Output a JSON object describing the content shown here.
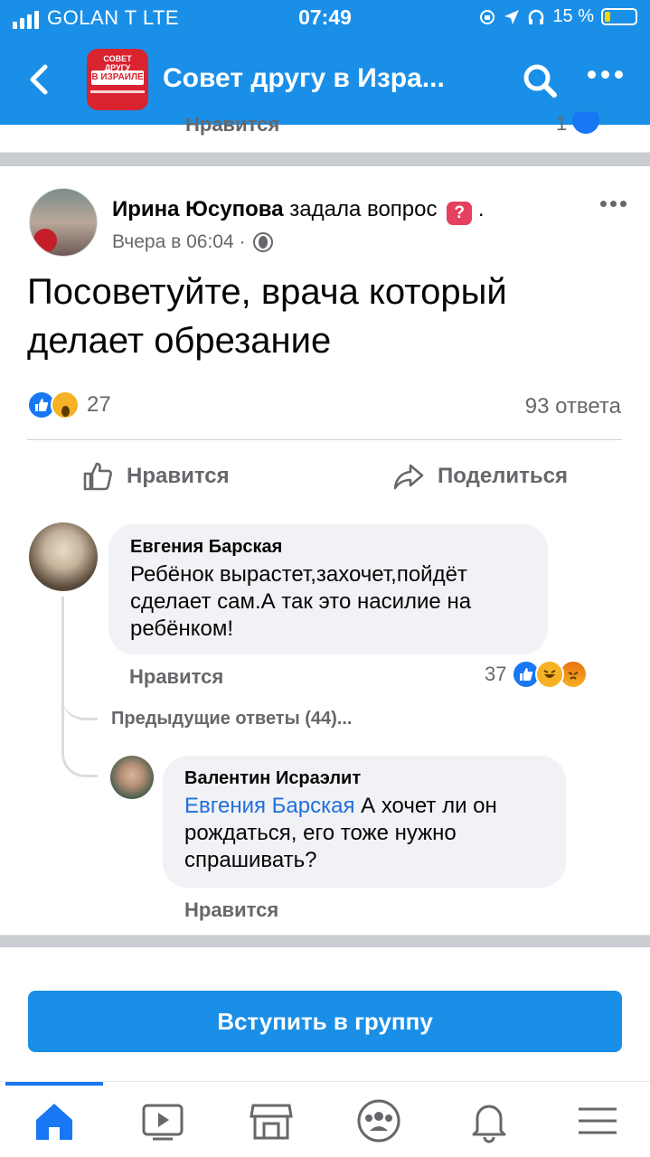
{
  "status": {
    "carrier": "GOLAN T  LTE",
    "time": "07:49",
    "battery": "15 %"
  },
  "header": {
    "group_title": "Совет другу в Изра...",
    "logo_line1": "СОВЕТ ДРУГУ",
    "logo_line2": "В ИЗРАИЛЕ"
  },
  "previous_post": {
    "like_label": "Нравится",
    "count": "1"
  },
  "post": {
    "author": "Ирина Юсупова",
    "action": "задала вопрос",
    "badge": "?",
    "dot": ".",
    "time": "Вчера в 06:04 ·",
    "text": "Посоветуйте, врача который делает обрезание",
    "reaction_count": "27",
    "answers": "93 ответа",
    "like_label": "Нравится",
    "share_label": "Поделиться"
  },
  "comments": [
    {
      "author": "Евгения Барская",
      "text": "Ребёнок вырастет,захочет,пойдёт сделает сам.А так это насилие на ребёнком!",
      "like_label": "Нравится",
      "reaction_count": "37"
    }
  ],
  "previous_replies": "Предыдущие ответы (44)...",
  "reply": {
    "author": "Валентин Исраэлит",
    "mention": "Евгения Барская",
    "text": " А хочет ли он рождаться, его тоже нужно спрашивать?",
    "like_label": "Нравится"
  },
  "join_button": "Вступить в группу",
  "bottom_nav": [
    "home-icon",
    "video-icon",
    "marketplace-icon",
    "groups-icon",
    "notifications-icon",
    "menu-icon"
  ],
  "colors": {
    "brand_blue": "#1a8fe8",
    "fb_blue": "#1877f2",
    "secondary_text": "#65676b",
    "bubble": "#f0f2f5"
  }
}
